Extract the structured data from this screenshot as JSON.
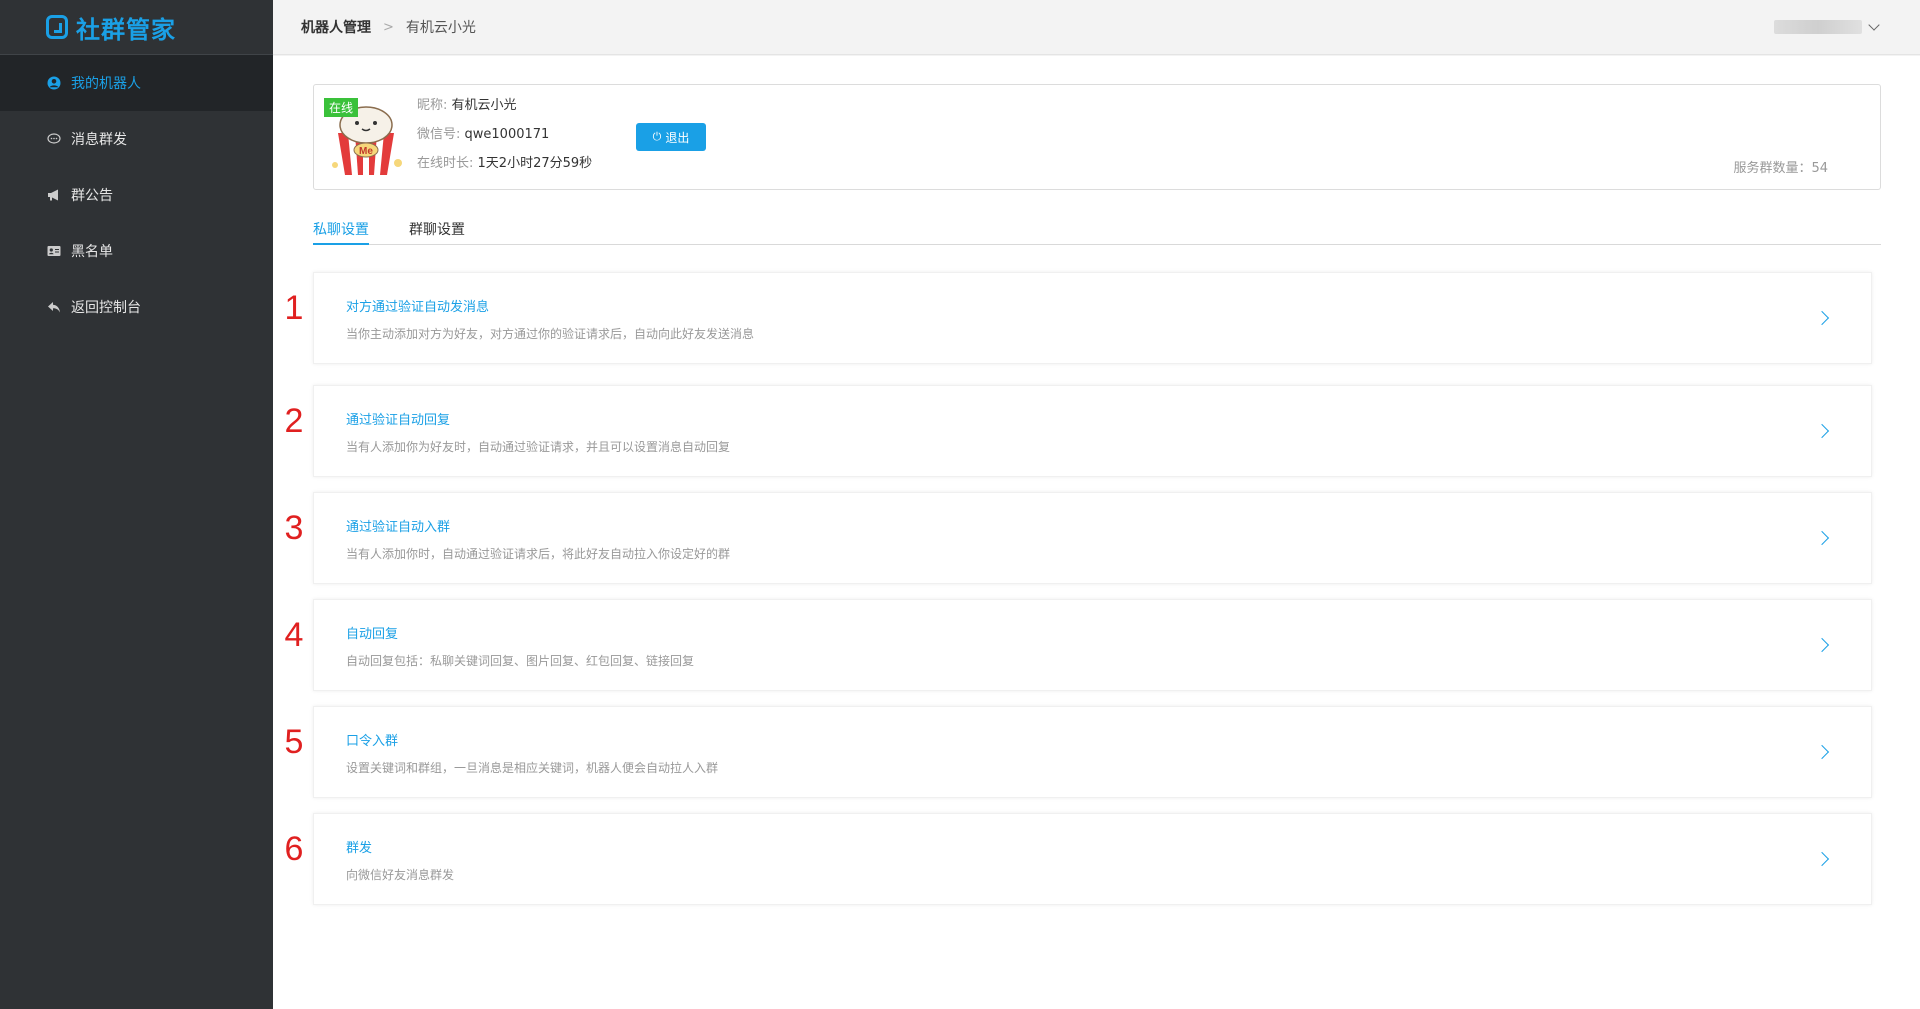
{
  "app": {
    "logo_text": "社群管家"
  },
  "sidebar": {
    "items": [
      {
        "label": "我的机器人",
        "icon": "user-circle-icon",
        "active": true
      },
      {
        "label": "消息群发",
        "icon": "chat-bubble-icon",
        "active": false
      },
      {
        "label": "群公告",
        "icon": "megaphone-icon",
        "active": false
      },
      {
        "label": "黑名单",
        "icon": "id-card-icon",
        "active": false
      },
      {
        "label": "返回控制台",
        "icon": "reply-arrow-icon",
        "active": false
      }
    ]
  },
  "breadcrumb": {
    "root": "机器人管理",
    "separator": ">",
    "current": "有机云小光"
  },
  "robot": {
    "status": "在线",
    "nickname_label": "昵称:",
    "nickname": "有机云小光",
    "wechat_label": "微信号:",
    "wechat": "qwe1000171",
    "online_label": "在线时长:",
    "online_duration": "1天2小时27分59秒",
    "logout_label": "退出",
    "service_groups": "服务群数量：54"
  },
  "tabs": [
    {
      "label": "私聊设置",
      "active": true
    },
    {
      "label": "群聊设置",
      "active": false
    }
  ],
  "settings": [
    {
      "num": "1",
      "title": "对方通过验证自动发消息",
      "desc": "当你主动添加对方为好友，对方通过你的验证请求后，自动向此好友发送消息"
    },
    {
      "num": "2",
      "title": "通过验证自动回复",
      "desc": "当有人添加你为好友时，自动通过验证请求，并且可以设置消息自动回复"
    },
    {
      "num": "3",
      "title": "通过验证自动入群",
      "desc": "当有人添加你时，自动通过验证请求后，将此好友自动拉入你设定好的群"
    },
    {
      "num": "4",
      "title": "自动回复",
      "desc": "自动回复包括：私聊关键词回复、图片回复、红包回复、链接回复"
    },
    {
      "num": "5",
      "title": "口令入群",
      "desc": "设置关键词和群组，一旦消息是相应关键词，机器人便会自动拉人入群"
    },
    {
      "num": "6",
      "title": "群发",
      "desc": "向微信好友消息群发"
    }
  ],
  "colors": {
    "accent": "#1aa0e6",
    "sidebar": "#2f3235",
    "online": "#3ac13a",
    "annotation": "#e02020"
  }
}
